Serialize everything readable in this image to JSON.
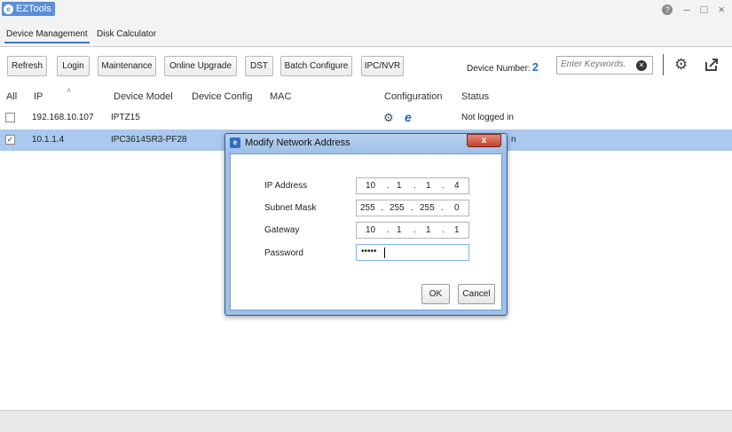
{
  "app": {
    "title": "EZTools",
    "logo_glyph": "e"
  },
  "window_controls": {
    "help": "?",
    "minimize": "–",
    "maximize": "□",
    "close": "×"
  },
  "tabs": [
    {
      "label": "Device Management",
      "active": true
    },
    {
      "label": "Disk Calculator",
      "active": false
    }
  ],
  "toolbar": {
    "buttons": [
      "Refresh",
      "Login",
      "Maintenance",
      "Online Upgrade",
      "DST",
      "Batch Configure",
      "IPC/NVR"
    ],
    "device_number_label": "Device Number:",
    "device_number_value": "2",
    "search_placeholder": "Enter Keywords.",
    "clear_glyph": "✕",
    "settings_icon": "gear-icon",
    "export_icon": "export-icon"
  },
  "table": {
    "columns": [
      "All",
      "IP",
      "Device Model",
      "Device Config",
      "MAC",
      "Configuration",
      "Status"
    ],
    "sort_indicator": "˄",
    "rows": [
      {
        "checked": false,
        "ip": "192.168.10.107",
        "model": "IPTZ15",
        "status": "Not logged in"
      },
      {
        "checked": true,
        "ip": "10.1.1.4",
        "model": "IPC3614SR3-PF28",
        "status": "n"
      }
    ]
  },
  "dialog": {
    "title": "Modify Network Address",
    "close_label": "x",
    "fields": [
      {
        "label": "IP Address",
        "octets": [
          "10",
          "1",
          "1",
          "4"
        ]
      },
      {
        "label": "Subnet Mask",
        "octets": [
          "255",
          "255",
          "255",
          "0"
        ]
      },
      {
        "label": "Gateway",
        "octets": [
          "10",
          "1",
          "1",
          "1"
        ]
      }
    ],
    "password_label": "Password",
    "password_value": "•••••",
    "ok_label": "OK",
    "cancel_label": "Cancel"
  },
  "colors": {
    "accent": "#3a76c8",
    "selected_row": "#a9c9ee",
    "dialog_frame": "#9dbfe8"
  }
}
